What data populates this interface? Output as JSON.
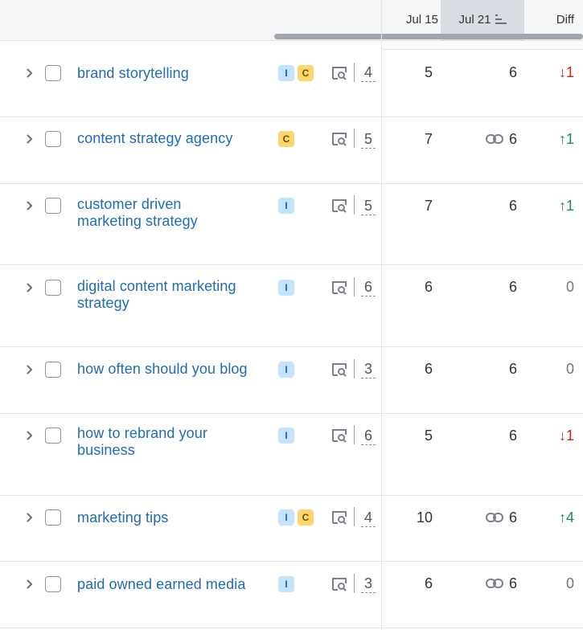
{
  "header": {
    "jul15": "Jul 15",
    "jul21": "Jul 21",
    "diff": "Diff"
  },
  "rows": [
    {
      "keyword": "brand storytelling",
      "intents": [
        "I",
        "C"
      ],
      "results": "4",
      "jul15": "5",
      "jul21": "6",
      "linked": false,
      "diff": "↓1",
      "diff_dir": "down"
    },
    {
      "keyword": "content strategy agency",
      "intents": [
        "C"
      ],
      "results": "5",
      "jul15": "7",
      "jul21": "6",
      "linked": true,
      "diff": "↑1",
      "diff_dir": "up"
    },
    {
      "keyword_line1": "customer driven",
      "keyword_line2": "marketing strategy",
      "intents": [
        "I"
      ],
      "results": "5",
      "jul15": "7",
      "jul21": "6",
      "linked": false,
      "diff": "↑1",
      "diff_dir": "up"
    },
    {
      "keyword_line1": "digital content marketing",
      "keyword_line2": "strategy",
      "intents": [
        "I"
      ],
      "results": "6",
      "jul15": "6",
      "jul21": "6",
      "linked": false,
      "diff": "0",
      "diff_dir": "zero"
    },
    {
      "keyword": "how often should you blog",
      "intents": [
        "I"
      ],
      "results": "3",
      "jul15": "6",
      "jul21": "6",
      "linked": false,
      "diff": "0",
      "diff_dir": "zero"
    },
    {
      "keyword_line1": "how to rebrand your",
      "keyword_line2": "business",
      "intents": [
        "I"
      ],
      "results": "6",
      "jul15": "5",
      "jul21": "6",
      "linked": false,
      "diff": "↓1",
      "diff_dir": "down"
    },
    {
      "keyword": "marketing tips",
      "intents": [
        "I",
        "C"
      ],
      "results": "4",
      "jul15": "10",
      "jul21": "6",
      "linked": true,
      "diff": "↑4",
      "diff_dir": "up"
    },
    {
      "keyword": "paid owned earned media",
      "intents": [
        "I"
      ],
      "results": "3",
      "jul15": "6",
      "jul21": "6",
      "linked": true,
      "diff": "0",
      "diff_dir": "zero"
    }
  ],
  "colors": {
    "link": "#1e6bb8",
    "intent_i": "#c2e3fb",
    "intent_c": "#fcd66a",
    "diff_down": "#c7231c",
    "diff_up": "#1b8a4b"
  }
}
